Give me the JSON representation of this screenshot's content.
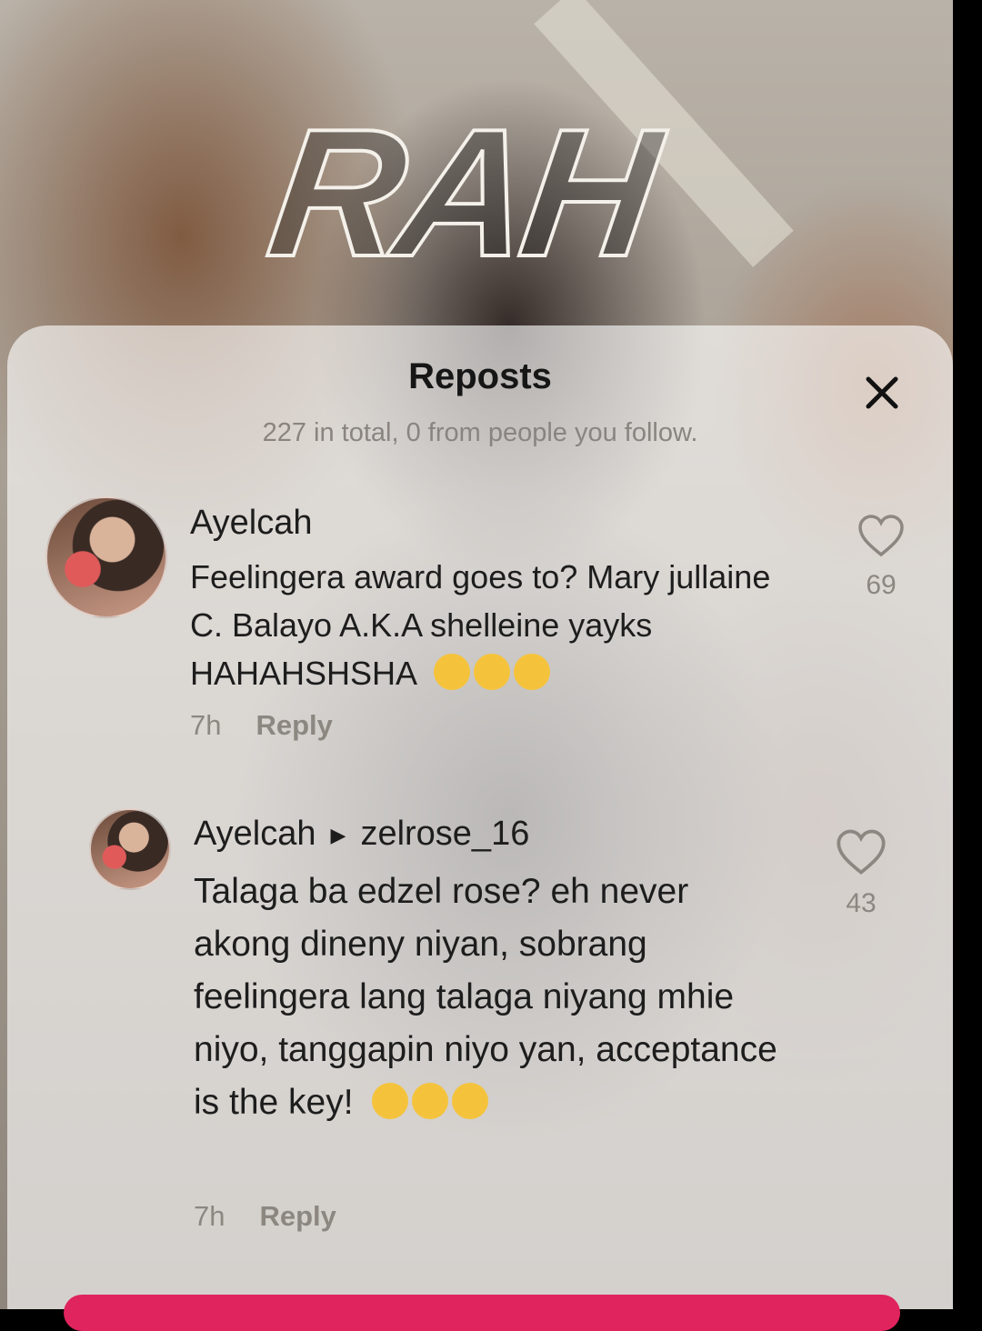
{
  "overlay": {
    "logo_text": "RAH"
  },
  "reposts_sheet": {
    "title": "Reposts",
    "subtitle": "227 in total, 0 from people you follow.",
    "close_icon": "close-icon"
  },
  "comments": [
    {
      "username": "Ayelcah",
      "text": "Feelingera award goes to? Mary jullaine C. Balayo A.K.A shelleine yayks HAHAHSHSHA",
      "emojis": [
        "rolling-on-floor-laughing",
        "rolling-on-floor-laughing",
        "rolling-on-floor-laughing"
      ],
      "time": "7h",
      "reply_label": "Reply",
      "likes": "69"
    },
    {
      "username": "Ayelcah",
      "reply_to": "zelrose_16",
      "text": "Talaga ba edzel rose? eh never akong dineny niyan, sobrang feelingera lang talaga niyang mhie niyo, tanggapin niyo yan, acceptance is the key!",
      "emojis": [
        "winking-face",
        "squinting-tongue-face",
        "rolling-on-floor-laughing"
      ],
      "time": "7h",
      "reply_label": "Reply",
      "likes": "43"
    }
  ],
  "colors": {
    "accent_bar": "#e0245e",
    "muted_text": "#8d8781"
  }
}
